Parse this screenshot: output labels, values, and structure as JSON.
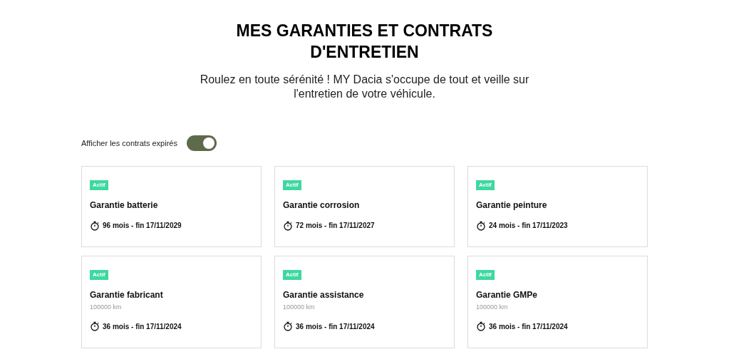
{
  "title": "MES GARANTIES ET CONTRATS D'ENTRETIEN",
  "subtitle": "Roulez en toute sérénité ! MY Dacia s'occupe de tout et veille sur l'entretien de votre véhicule.",
  "toggle": {
    "label": "Afficher les contrats expirés",
    "on": true
  },
  "cards": [
    {
      "status": "Actif",
      "title": "Garantie batterie",
      "duration": "96 mois - fin 17/11/2029"
    },
    {
      "status": "Actif",
      "title": "Garantie corrosion",
      "duration": "72 mois - fin 17/11/2027"
    },
    {
      "status": "Actif",
      "title": "Garantie peinture",
      "duration": "24 mois - fin 17/11/2023"
    },
    {
      "status": "Actif",
      "title": "Garantie fabricant",
      "mileage": "100000 km",
      "duration": "36 mois - fin 17/11/2024"
    },
    {
      "status": "Actif",
      "title": "Garantie assistance",
      "mileage": "100000 km",
      "duration": "36 mois - fin 17/11/2024"
    },
    {
      "status": "Actif",
      "title": "Garantie GMPe",
      "mileage": "100000 km",
      "duration": "36 mois - fin 17/11/2024"
    }
  ]
}
